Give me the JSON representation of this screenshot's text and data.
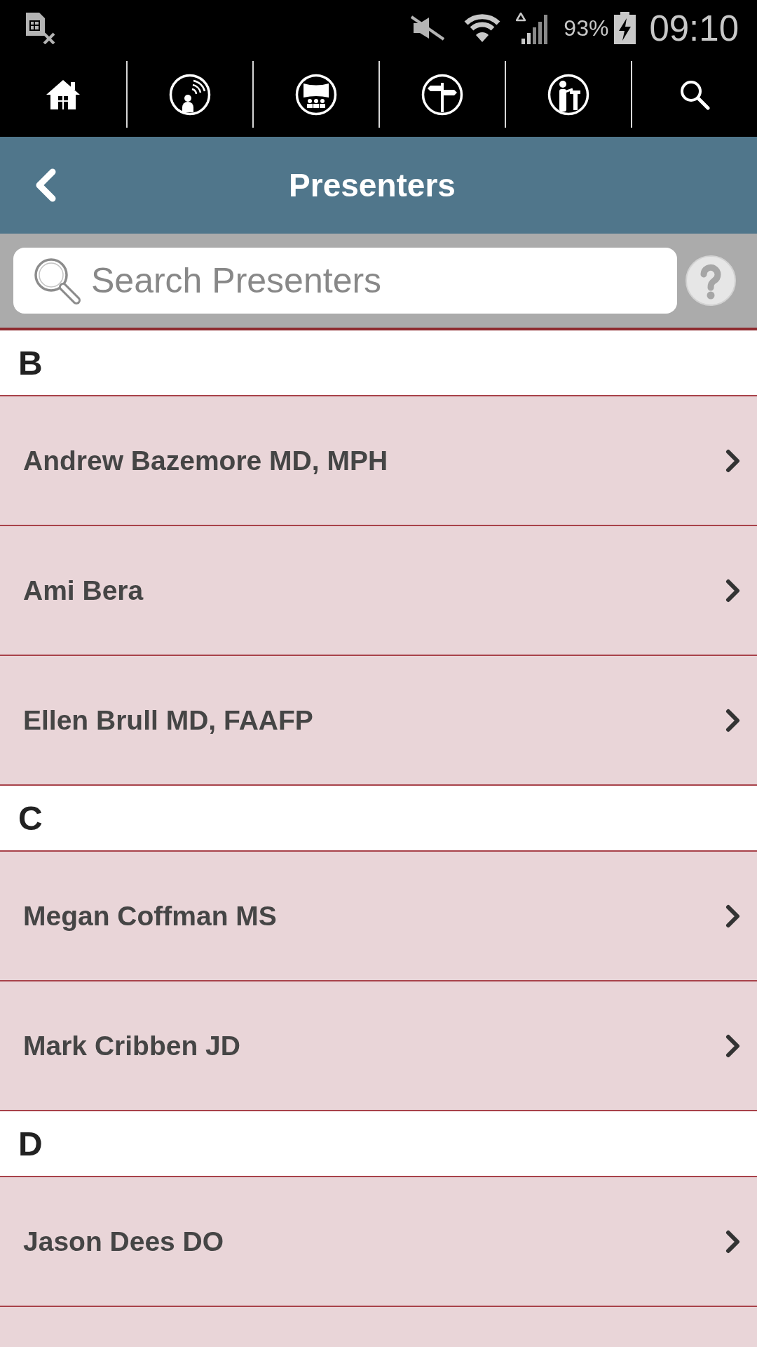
{
  "status_bar": {
    "battery": "93%",
    "time": "09:10"
  },
  "header": {
    "title": "Presenters"
  },
  "search": {
    "placeholder": "Search Presenters"
  },
  "sections": [
    {
      "letter": "B",
      "presenters": [
        "Andrew Bazemore MD, MPH",
        "Ami Bera",
        "Ellen Brull MD, FAAFP"
      ]
    },
    {
      "letter": "C",
      "presenters": [
        "Megan Coffman MS",
        "Mark Cribben JD"
      ]
    },
    {
      "letter": "D",
      "presenters": [
        "Jason Dees DO"
      ]
    }
  ]
}
